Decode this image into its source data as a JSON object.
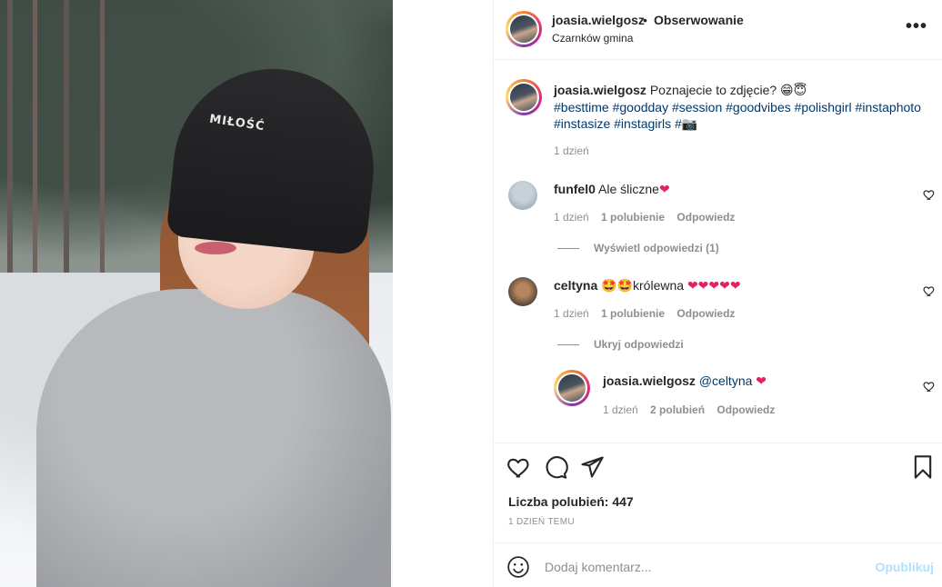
{
  "post": {
    "username": "joasia.wielgosz",
    "separator": "•",
    "follow_label": "Obserwowanie",
    "location": "Czarnków gmina",
    "more_label": "•••",
    "photo_text": "MIŁOŚĆ"
  },
  "caption": {
    "username": "joasia.wielgosz",
    "text": "Poznajecie to zdjęcie? 😁😇",
    "hashtags_line1": "#besttime #goodday #session #goodvibes #polishgirl #instaphoto",
    "hashtags_line2a": "#instasize #instagirls #",
    "hashtags_line2b": "📷",
    "time": "1 dzień"
  },
  "comments": [
    {
      "username": "funfel0",
      "text": "Ale śliczne",
      "emoji": "❤",
      "time": "1 dzień",
      "likes": "1 polubienie",
      "reply_label": "Odpowiedz",
      "replies_toggle": "Wyświetl odpowiedzi (1)"
    },
    {
      "username": "celtyna",
      "text_prefix": "🤩🤩",
      "text": "królewna",
      "emoji": "❤❤❤❤❤",
      "time": "1 dzień",
      "likes": "1 polubienie",
      "reply_label": "Odpowiedz",
      "replies_toggle": "Ukryj odpowiedzi"
    }
  ],
  "reply": {
    "username": "joasia.wielgosz",
    "text": "@celtyna",
    "emoji": "❤",
    "time": "1 dzień",
    "likes": "2 polubień",
    "reply_label": "Odpowiedz"
  },
  "actions": {
    "likes_text": "Liczba polubień: 447",
    "date_text": "1 DZIEŃ TEMU",
    "icons": [
      "heart-icon",
      "comment-icon",
      "share-icon",
      "bookmark-icon"
    ]
  },
  "add_comment": {
    "placeholder": "Dodaj komentarz...",
    "publish_label": "Opublikuj"
  },
  "colors": {
    "hashtag": "#00376b",
    "muted": "#8e8e8e",
    "heart": "#e0245e",
    "publish_disabled": "#b2dffc"
  }
}
